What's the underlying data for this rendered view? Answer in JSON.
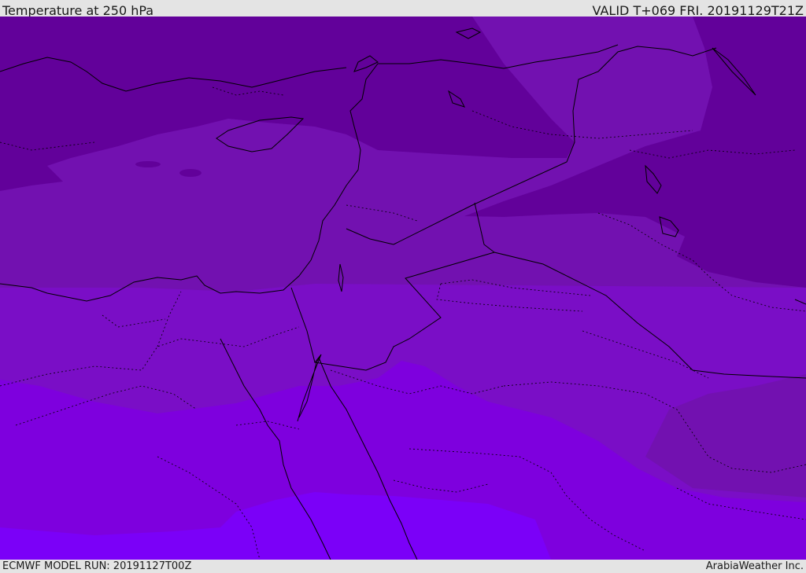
{
  "header": {
    "title": "Temperature at 250 hPa",
    "valid": "VALID T+069 FRI. 20191129T21Z"
  },
  "footer": {
    "model_run": "ECMWF MODEL RUN: 20191127T00Z",
    "brand": "ArabiaWeather Inc."
  },
  "map": {
    "colors": {
      "darkest": "#62019a",
      "dark": "#7211b0",
      "medium": "#7a0ec6",
      "violet": "#7e00de",
      "bright": "#7b00f8",
      "lines": "#000000"
    }
  }
}
